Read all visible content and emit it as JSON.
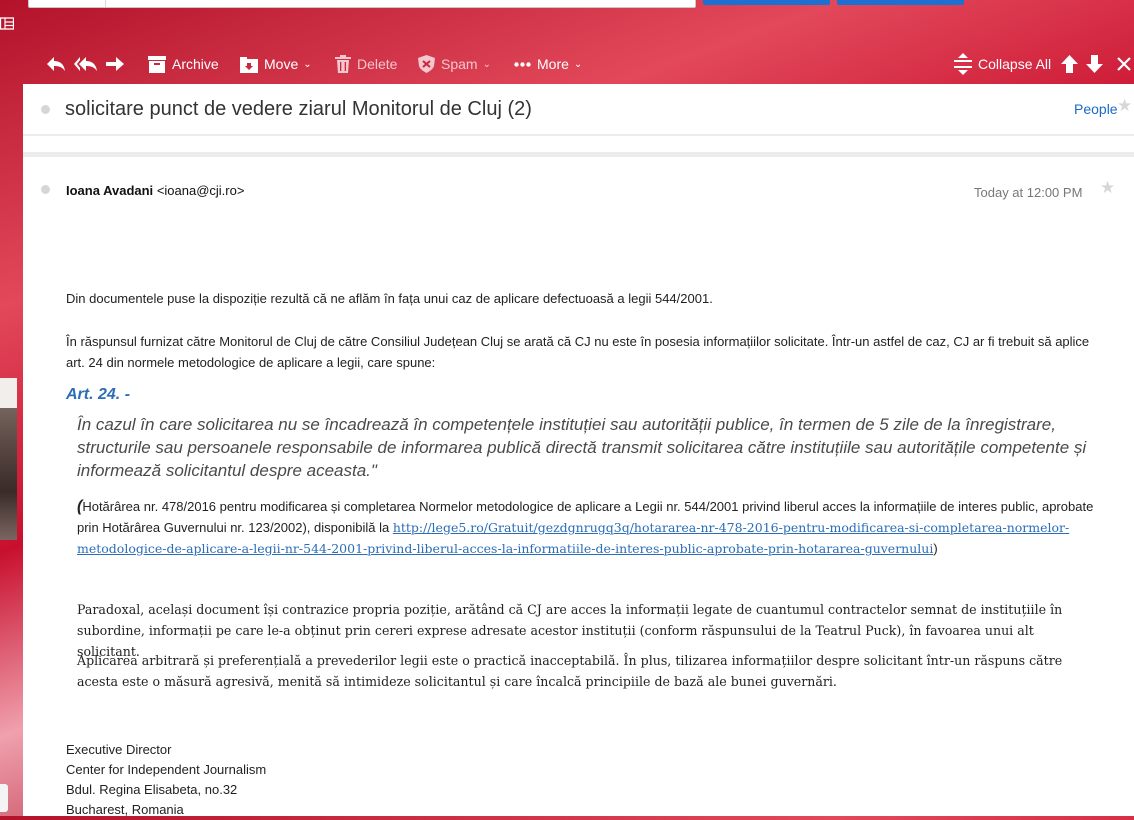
{
  "toolbar": {
    "archive": "Archive",
    "move": "Move",
    "delete": "Delete",
    "spam": "Spam",
    "more": "More",
    "collapse_all": "Collapse All"
  },
  "thread": {
    "subject": "solicitare punct de vedere ziarul Monitorul de Cluj (2)",
    "people": "People"
  },
  "message": {
    "sender_name": "Ioana Avadani",
    "sender_email": "<ioana@cji.ro>",
    "date": "Today at 12:00 PM",
    "p1": "Din documentele puse la dispoziție rezultă că ne aflăm în fața unui caz de aplicare defectuoasă a legii 544/2001.",
    "p2": "În răspunsul furnizat către Monitorul de Cluj de către Consiliul Județean Cluj se arată că CJ nu este în posesia informațiilor solicitate. Într-un astfel de caz, CJ ar fi trebuit să aplice art. 24 din normele metodologice de aplicare a legii, care spune:",
    "article_title": "Art. 24. -",
    "quote": "În cazul în care solicitarea nu se încadrează în competențele instituției sau autorității publice, în termen de 5 zile de la înregistrare, structurile sau persoanele responsabile de informarea publică directă transmit solicitarea către instituțiile sau autoritățile competente și informează solicitantul despre aceasta.\"",
    "source_open": "(",
    "source_text": "Hotărârea nr. 478/2016 pentru modificarea și completarea Normelor metodologice de aplicare a Legii nr. 544/2001 privind liberul acces la informațiile de interes public, aprobate prin Hotărârea Guvernului nr. 123/2002), disponibilă la ",
    "source_link": "http://lege5.ro/Gratuit/gezdgnrugq3q/hotararea-nr-478-2016-pentru-modificarea-si-completarea-normelor-metodologice-de-aplicare-a-legii-nr-544-2001-privind-liberul-acces-la-informatiile-de-interes-public-aprobate-prin-hotararea-guvernului",
    "source_close": ")",
    "p4": "Paradoxal, același document își contrazice propria poziție, arătând că CJ are acces la informații legate de cuantumul contractelor semnat de instituțiile în subordine, informații pe care le-a obținut prin cereri exprese adresate acestor instituții (conform răspunsului de la Teatrul Puck), în favoarea unui alt solicitant.",
    "p5": "Aplicarea arbitrară și preferențială a prevederilor legii este o practică inacceptabilă.  În plus, tilizarea informațiilor despre solicitant într-un răspuns către acesta este o măsură agresivă, menită să intimideze solicitantul și care încalcă  principiile de bază ale bunei guvernări.",
    "signature": [
      "Executive Director",
      "Center for Independent Journalism",
      "Bdul. Regina Elisabeta, no.32",
      "Bucharest, Romania"
    ]
  },
  "colors": {
    "accent_link": "#1a6ac7",
    "article_title": "#2f6db5",
    "toolbar_text": "#ffffff"
  }
}
